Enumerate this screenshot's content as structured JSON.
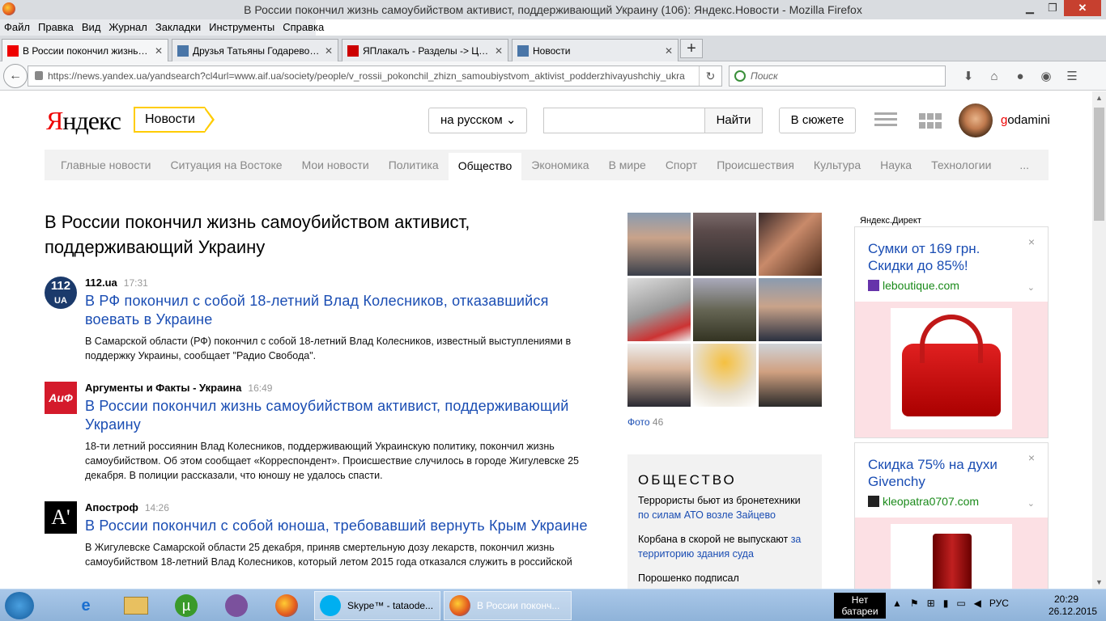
{
  "window": {
    "title": "В России покончил жизнь самоубийством активист, поддерживающий Украину (106): Яндекс.Новости - Mozilla Firefox"
  },
  "menu": [
    "Файл",
    "Правка",
    "Вид",
    "Журнал",
    "Закладки",
    "Инструменты",
    "Справка"
  ],
  "tabs": [
    {
      "label": "В России покончил жизнь с..."
    },
    {
      "label": "Друзья Татьяны Годаревой | ..."
    },
    {
      "label": "ЯПлакалъ - Разделы -> Цит..."
    },
    {
      "label": "Новости"
    }
  ],
  "newtab": "+",
  "url": "https://news.yandex.ua/yandsearch?cl4url=www.aif.ua/society/people/v_rossii_pokonchil_zhizn_samoubiystvom_aktivist_podderzhivayushchiy_ukra",
  "search_placeholder": "Поиск",
  "header": {
    "logo_red": "Я",
    "logo_rest": "ндекс",
    "news_label": "Новости",
    "lang": "на русском",
    "find": "Найти",
    "story": "В сюжете",
    "user_red": "g",
    "user_rest": "odamini"
  },
  "categories": [
    "Главные новости",
    "Ситуация на Востоке",
    "Мои новости",
    "Политика",
    "Общество",
    "Экономика",
    "В мире",
    "Спорт",
    "Происшествия",
    "Культура",
    "Наука",
    "Технологии",
    "..."
  ],
  "active_category": "Общество",
  "headline": "В России покончил жизнь самоубийством активист, поддерживающий Украину",
  "stories": [
    {
      "source": "112.ua",
      "time": "17:31",
      "title": "В РФ покончил с собой 18-летний Влад Колесников, отказавшийся воевать в Украине",
      "text": "В Самарской области (РФ) покончил с собой 18-летний Влад Колесников, известный выступлениями в поддержку Украины, сообщает \"Радио Свобода\".",
      "logo_text": "112",
      "logo_sub": "UA"
    },
    {
      "source": "Аргументы и Факты - Украина",
      "time": "16:49",
      "title": "В России покончил жизнь самоубийством активист, поддерживающий Украину",
      "text": "18-ти летний россиянин Влад Колесников, поддерживающий Украинскую политику, покончил жизнь самоубийством. Об этом сообщает «Корреспондент». Происшествие случилось в городе Жигулевске 25 декабря. В полиции рассказали, что юношу не удалось спасти.",
      "logo_text": "АиФ"
    },
    {
      "source": "Апостроф",
      "time": "14:26",
      "title": "В России покончил с собой юноша, требовавший вернуть Крым Украине",
      "text": "В Жигулевске Самарской области 25 декабря, приняв смертельную дозу лекарств, покончил жизнь самоубийством 18-летний Влад Колесников, который летом 2015 года отказался служить в российской",
      "logo_text": "A'"
    }
  ],
  "photos": {
    "label": "Фото",
    "count": "46"
  },
  "society": {
    "title": "ОБЩЕСТВО",
    "items": [
      {
        "text": "Террористы бьют из бронетехники ",
        "link": "по силам АТО возле Зайцево"
      },
      {
        "text": "Корбана в скорой не выпускают ",
        "link": "за территорию здания суда"
      },
      {
        "text": "Порошенко подписал",
        "link": ""
      }
    ]
  },
  "direct_label": "Яндекс.Директ",
  "ads": [
    {
      "title": "Сумки от 169 грн. Скидки до 85%!",
      "site": "leboutique.com",
      "close": "×"
    },
    {
      "title": "Скидка 75% на духи Givenchy",
      "site": "kleopatra0707.com",
      "close": "×"
    }
  ],
  "taskbar": {
    "skype": "Skype™ - tataode...",
    "firefox": "В России поконч...",
    "battery": "Нет батареи",
    "lang": "РУС",
    "time": "20:29",
    "date": "26.12.2015"
  },
  "colors": {
    "link": "#1a4db3",
    "accent": "#ffcc00",
    "yandex_red": "#ee0000"
  }
}
